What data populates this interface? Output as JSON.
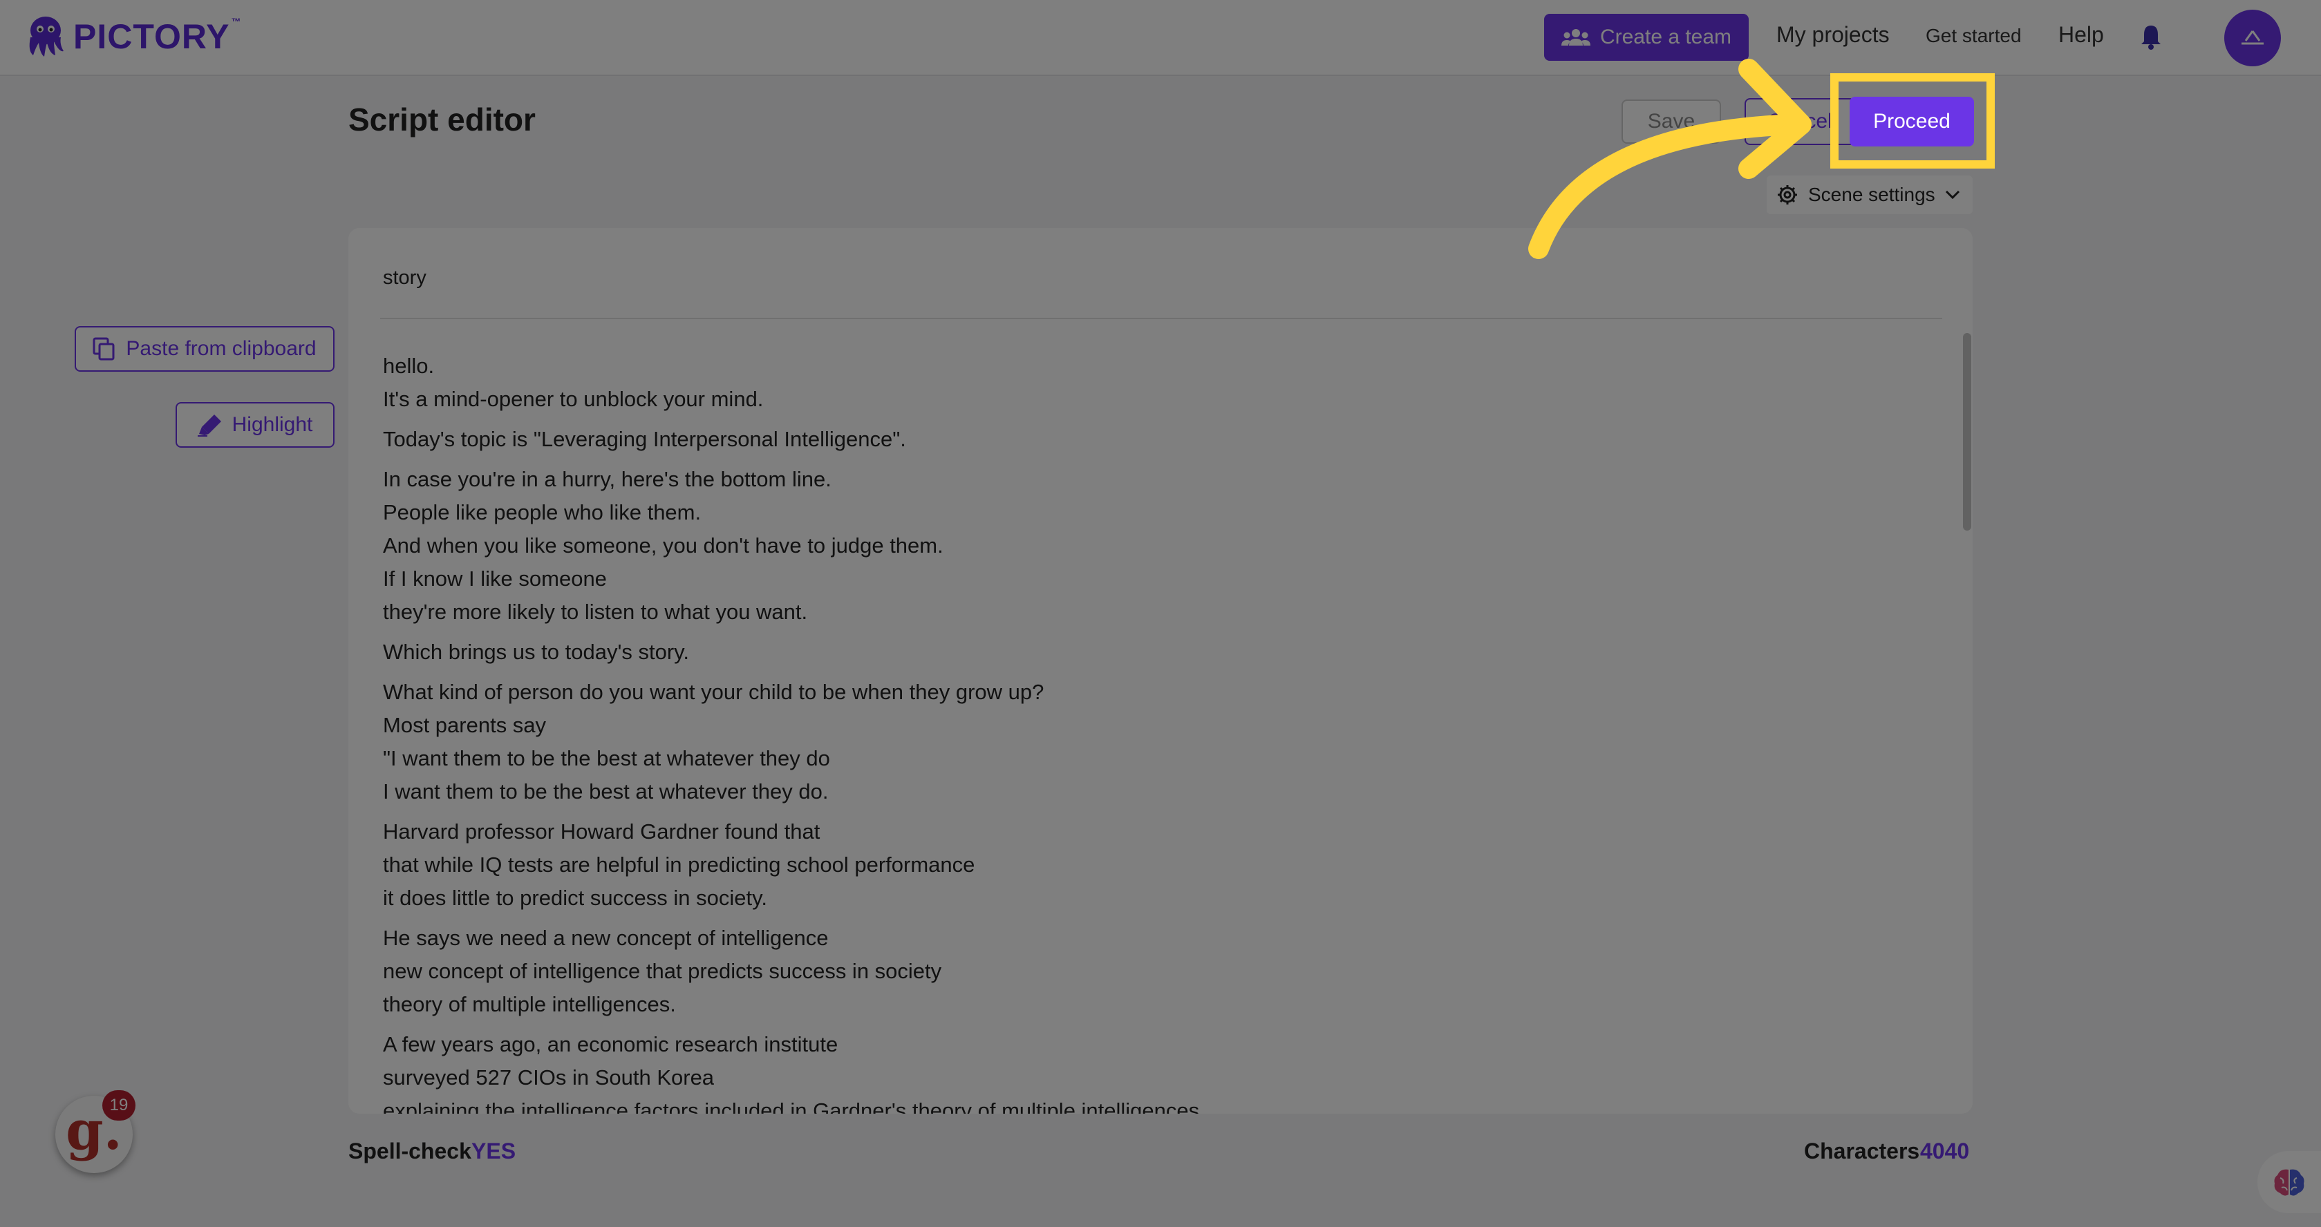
{
  "app": {
    "brand_name": "PICTORY",
    "brand_tm": "™"
  },
  "header": {
    "create_team_label": "Create a team",
    "my_projects_label": "My projects",
    "get_started_label": "Get started",
    "help_label": "Help"
  },
  "page": {
    "title": "Script editor",
    "save_label": "Save",
    "cancel_label": "Cancel",
    "proceed_label": "Proceed",
    "scene_settings_label": "Scene settings"
  },
  "sidebar": {
    "paste_label": "Paste from clipboard",
    "highlight_label": "Highlight"
  },
  "editor": {
    "title": "story",
    "paragraphs": [
      [
        "hello.",
        "It's a mind-opener to unblock your mind."
      ],
      [
        "Today's topic is \"Leveraging Interpersonal Intelligence\"."
      ],
      [
        "In case you're in a hurry, here's the bottom line.",
        "People like people who like them.",
        "And when you like someone, you don't have to judge them.",
        "If I know I like someone",
        "they're more likely to listen to what you want."
      ],
      [
        "Which brings us to today's story."
      ],
      [
        "What kind of person do you want your child to be when they grow up?",
        "Most parents say",
        "\"I want them to be the best at whatever they do",
        "I want them to be the best at whatever they do."
      ],
      [
        "Harvard professor Howard Gardner found that",
        "that while IQ tests are helpful in predicting school performance",
        "it does little to predict success in society."
      ],
      [
        "He says we need a new concept of intelligence",
        "new concept of intelligence that predicts success in society",
        "theory of multiple intelligences."
      ],
      [
        "A few years ago, an economic research institute",
        "surveyed 527 CIOs in South Korea",
        "explaining the intelligence factors included in Gardner's theory of multiple intelligences."
      ]
    ]
  },
  "footer": {
    "spell_check_label": "Spell-check",
    "spell_check_value": "YES",
    "characters_label": "Characters",
    "characters_value": "4040"
  },
  "widget": {
    "letter": "g.",
    "badge_count": "19"
  },
  "colors": {
    "accent": "#6b35e6",
    "highlight": "#ffd43b",
    "overlay": "rgba(0,0,0,0.5)"
  },
  "icons": {
    "team": "team-icon",
    "bell": "bell-icon",
    "avatar": "avatar-icon",
    "gear": "gear-icon",
    "chevron": "chevron-down-icon",
    "copy": "copy-icon",
    "pen": "highlighter-icon",
    "brain": "brain-icon",
    "arrow": "arrow-annotation-icon"
  }
}
